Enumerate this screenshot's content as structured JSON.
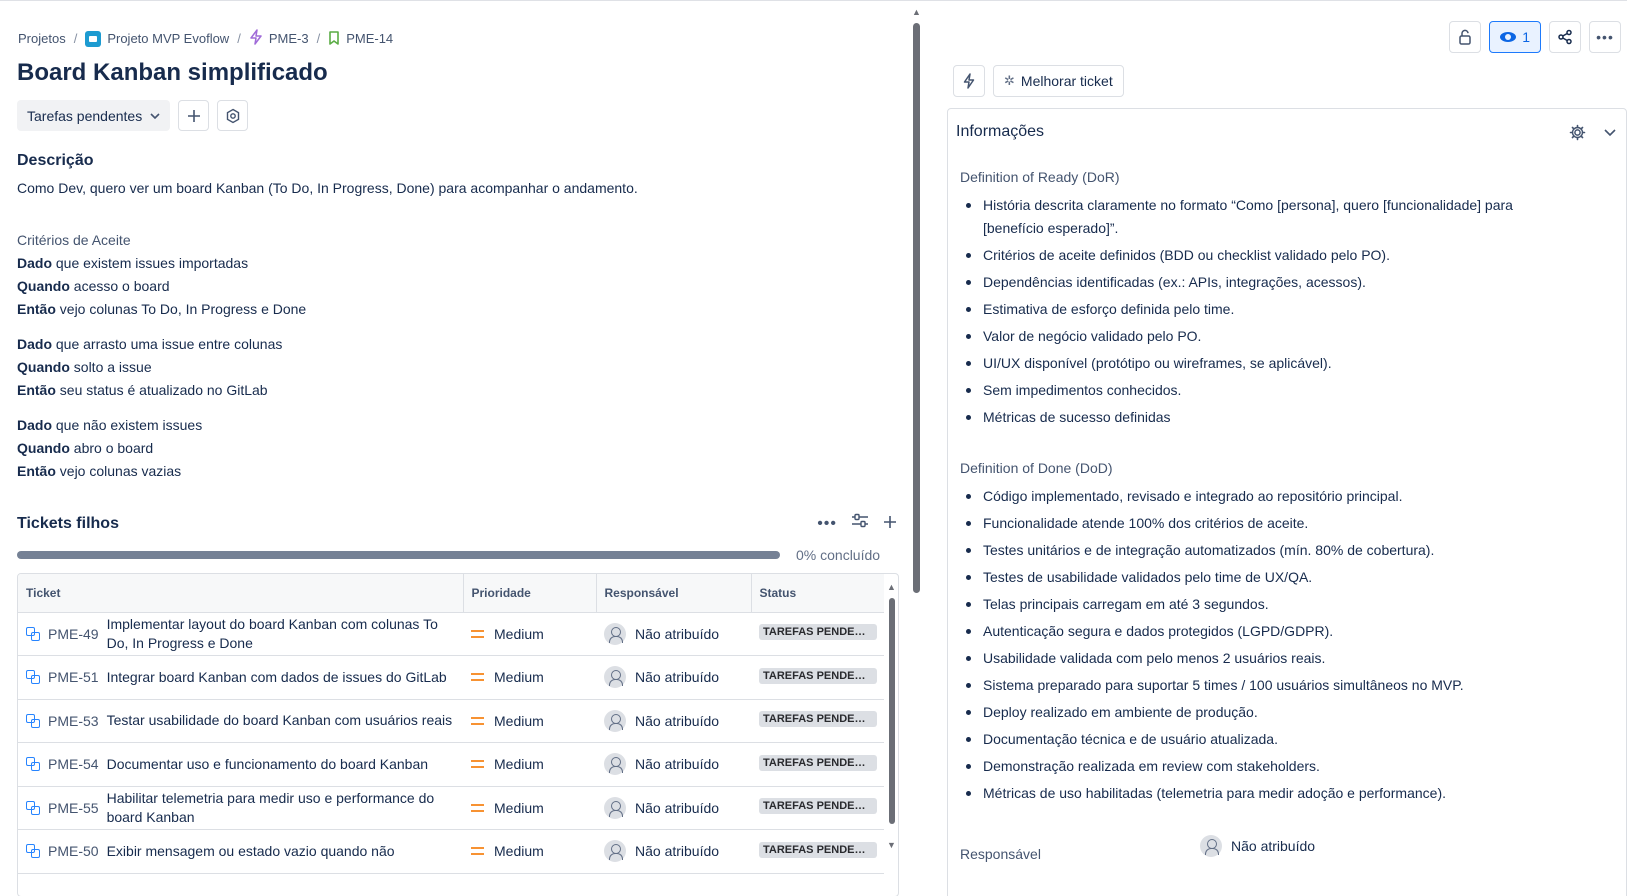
{
  "breadcrumb": {
    "projects": "Projetos",
    "project": "Projeto MVP Evoflow",
    "epic": "PME-3",
    "issue": "PME-14"
  },
  "title": "Board Kanban simplificado",
  "status": {
    "label": "Tarefas pendentes"
  },
  "description": {
    "heading": "Descrição",
    "text": "Como Dev, quero ver um board Kanban (To Do, In Progress, Done) para acompanhar o andamento.",
    "criteria_heading": "Critérios de Aceite",
    "scenarios": [
      [
        {
          "kw": "Dado",
          "text": " que existem issues importadas"
        },
        {
          "kw": "Quando",
          "text": " acesso o board"
        },
        {
          "kw": "Então",
          "text": " vejo colunas To Do, In Progress e Done"
        }
      ],
      [
        {
          "kw": "Dado",
          "text": " que arrasto uma issue entre colunas"
        },
        {
          "kw": "Quando",
          "text": " solto a issue"
        },
        {
          "kw": "Então",
          "text": " seu status é atualizado no GitLab"
        }
      ],
      [
        {
          "kw": "Dado",
          "text": " que não existem issues"
        },
        {
          "kw": "Quando",
          "text": " abro o board"
        },
        {
          "kw": "Então",
          "text": " vejo colunas vazias"
        }
      ]
    ]
  },
  "children": {
    "heading": "Tickets filhos",
    "progress_percent": 0,
    "progress_label": "0% concluído",
    "columns": [
      "Ticket",
      "Prioridade",
      "Responsável",
      "Status"
    ],
    "rows": [
      {
        "key": "PME-49",
        "summary": "Implementar layout do board Kanban com colunas To Do, In Progress e Done",
        "priority": "Medium",
        "assignee": "Não atribuído",
        "status": "TAREFAS PENDENTES"
      },
      {
        "key": "PME-51",
        "summary": "Integrar board Kanban com dados de issues do GitLab",
        "priority": "Medium",
        "assignee": "Não atribuído",
        "status": "TAREFAS PENDENTES"
      },
      {
        "key": "PME-53",
        "summary": "Testar usabilidade do board Kanban com usuários reais",
        "priority": "Medium",
        "assignee": "Não atribuído",
        "status": "TAREFAS PENDENTES"
      },
      {
        "key": "PME-54",
        "summary": "Documentar uso e funcionamento do board Kanban",
        "priority": "Medium",
        "assignee": "Não atribuído",
        "status": "TAREFAS PENDENTES"
      },
      {
        "key": "PME-55",
        "summary": "Habilitar telemetria para medir uso e performance do board Kanban",
        "priority": "Medium",
        "assignee": "Não atribuído",
        "status": "TAREFAS PENDENTES"
      },
      {
        "key": "PME-50",
        "summary": "Exibir mensagem ou estado vazio quando não",
        "priority": "Medium",
        "assignee": "Não atribuído",
        "status": "TAREFAS PENDENTES"
      }
    ]
  },
  "toolbar": {
    "watchers_count": "1",
    "improve_label": "Melhorar ticket"
  },
  "info": {
    "heading": "Informações",
    "dor_heading": "Definition of Ready (DoR)",
    "dor_items": [
      "História descrita claramente no formato “Como [persona], quero [funcionalidade] para [benefício esperado]”.",
      "Critérios de aceite definidos (BDD ou checklist validado pelo PO).",
      "Dependências identificadas (ex.: APIs, integrações, acessos).",
      "Estimativa de esforço definida pelo time.",
      "Valor de negócio validado pelo PO.",
      "UI/UX disponível (protótipo ou wireframes, se aplicável).",
      "Sem impedimentos conhecidos.",
      "Métricas de sucesso definidas"
    ],
    "dod_heading": "Definition of Done (DoD)",
    "dod_items": [
      "Código implementado, revisado e integrado ao repositório principal.",
      "Funcionalidade atende 100% dos critérios de aceite.",
      "Testes unitários e de integração automatizados (mín. 80% de cobertura).",
      "Testes de usabilidade validados pelo time de UX/QA.",
      "Telas principais carregam em até 3 segundos.",
      "Autenticação segura e dados protegidos (LGPD/GDPR).",
      "Usabilidade validada com pelo menos 2 usuários reais.",
      "Sistema preparado para suportar 5 times / 100 usuários simultâneos no MVP.",
      "Deploy realizado em ambiente de produção.",
      "Documentação técnica e de usuário atualizada.",
      "Demonstração realizada em review com stakeholders.",
      "Métricas de uso habilitadas (telemetria para medir adoção e performance)."
    ],
    "assignee_label": "Responsável",
    "assignee_value": "Não atribuído"
  },
  "icons": {
    "project": "project-icon",
    "epic": "epic-lightning-icon",
    "story": "story-bookmark-icon",
    "subtask": "subtask-icon",
    "priority_medium": "priority-medium-icon",
    "lock": "lock-icon",
    "eye": "eye-icon",
    "share": "share-icon",
    "more": "more-icon",
    "bolt": "bolt-icon",
    "sparkle": "sparkle-icon",
    "gear": "gear-icon",
    "chevron": "chevron-down-icon"
  },
  "colors": {
    "accent": "#0c66e4",
    "priority_medium": "#f79232",
    "lozenge_bg": "#dcdfe4"
  }
}
